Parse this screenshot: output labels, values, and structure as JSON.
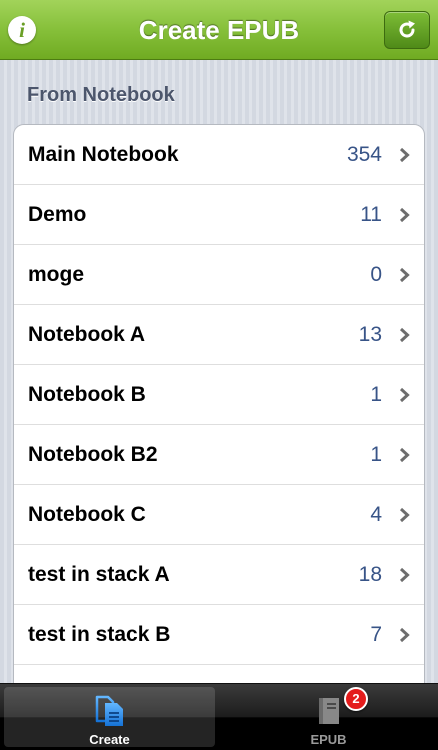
{
  "navbar": {
    "title": "Create EPUB",
    "info_icon": "info-icon",
    "refresh_icon": "refresh-icon"
  },
  "section": {
    "header": "From Notebook"
  },
  "notebooks": [
    {
      "name": "Main Notebook",
      "count": "354"
    },
    {
      "name": "Demo",
      "count": "11"
    },
    {
      "name": "moge",
      "count": "0"
    },
    {
      "name": "Notebook A",
      "count": "13"
    },
    {
      "name": "Notebook B",
      "count": "1"
    },
    {
      "name": "Notebook B2",
      "count": "1"
    },
    {
      "name": "Notebook C",
      "count": "4"
    },
    {
      "name": "test in stack A",
      "count": "18"
    },
    {
      "name": "test in stack B",
      "count": "7"
    }
  ],
  "tabbar": {
    "tabs": [
      {
        "label": "Create",
        "icon": "create-document-icon",
        "selected": true
      },
      {
        "label": "EPUB",
        "icon": "book-icon",
        "badge": "2"
      }
    ]
  },
  "colors": {
    "navbar_green": "#86c03a",
    "count_blue": "#385487",
    "badge_red": "#e41c1c"
  }
}
